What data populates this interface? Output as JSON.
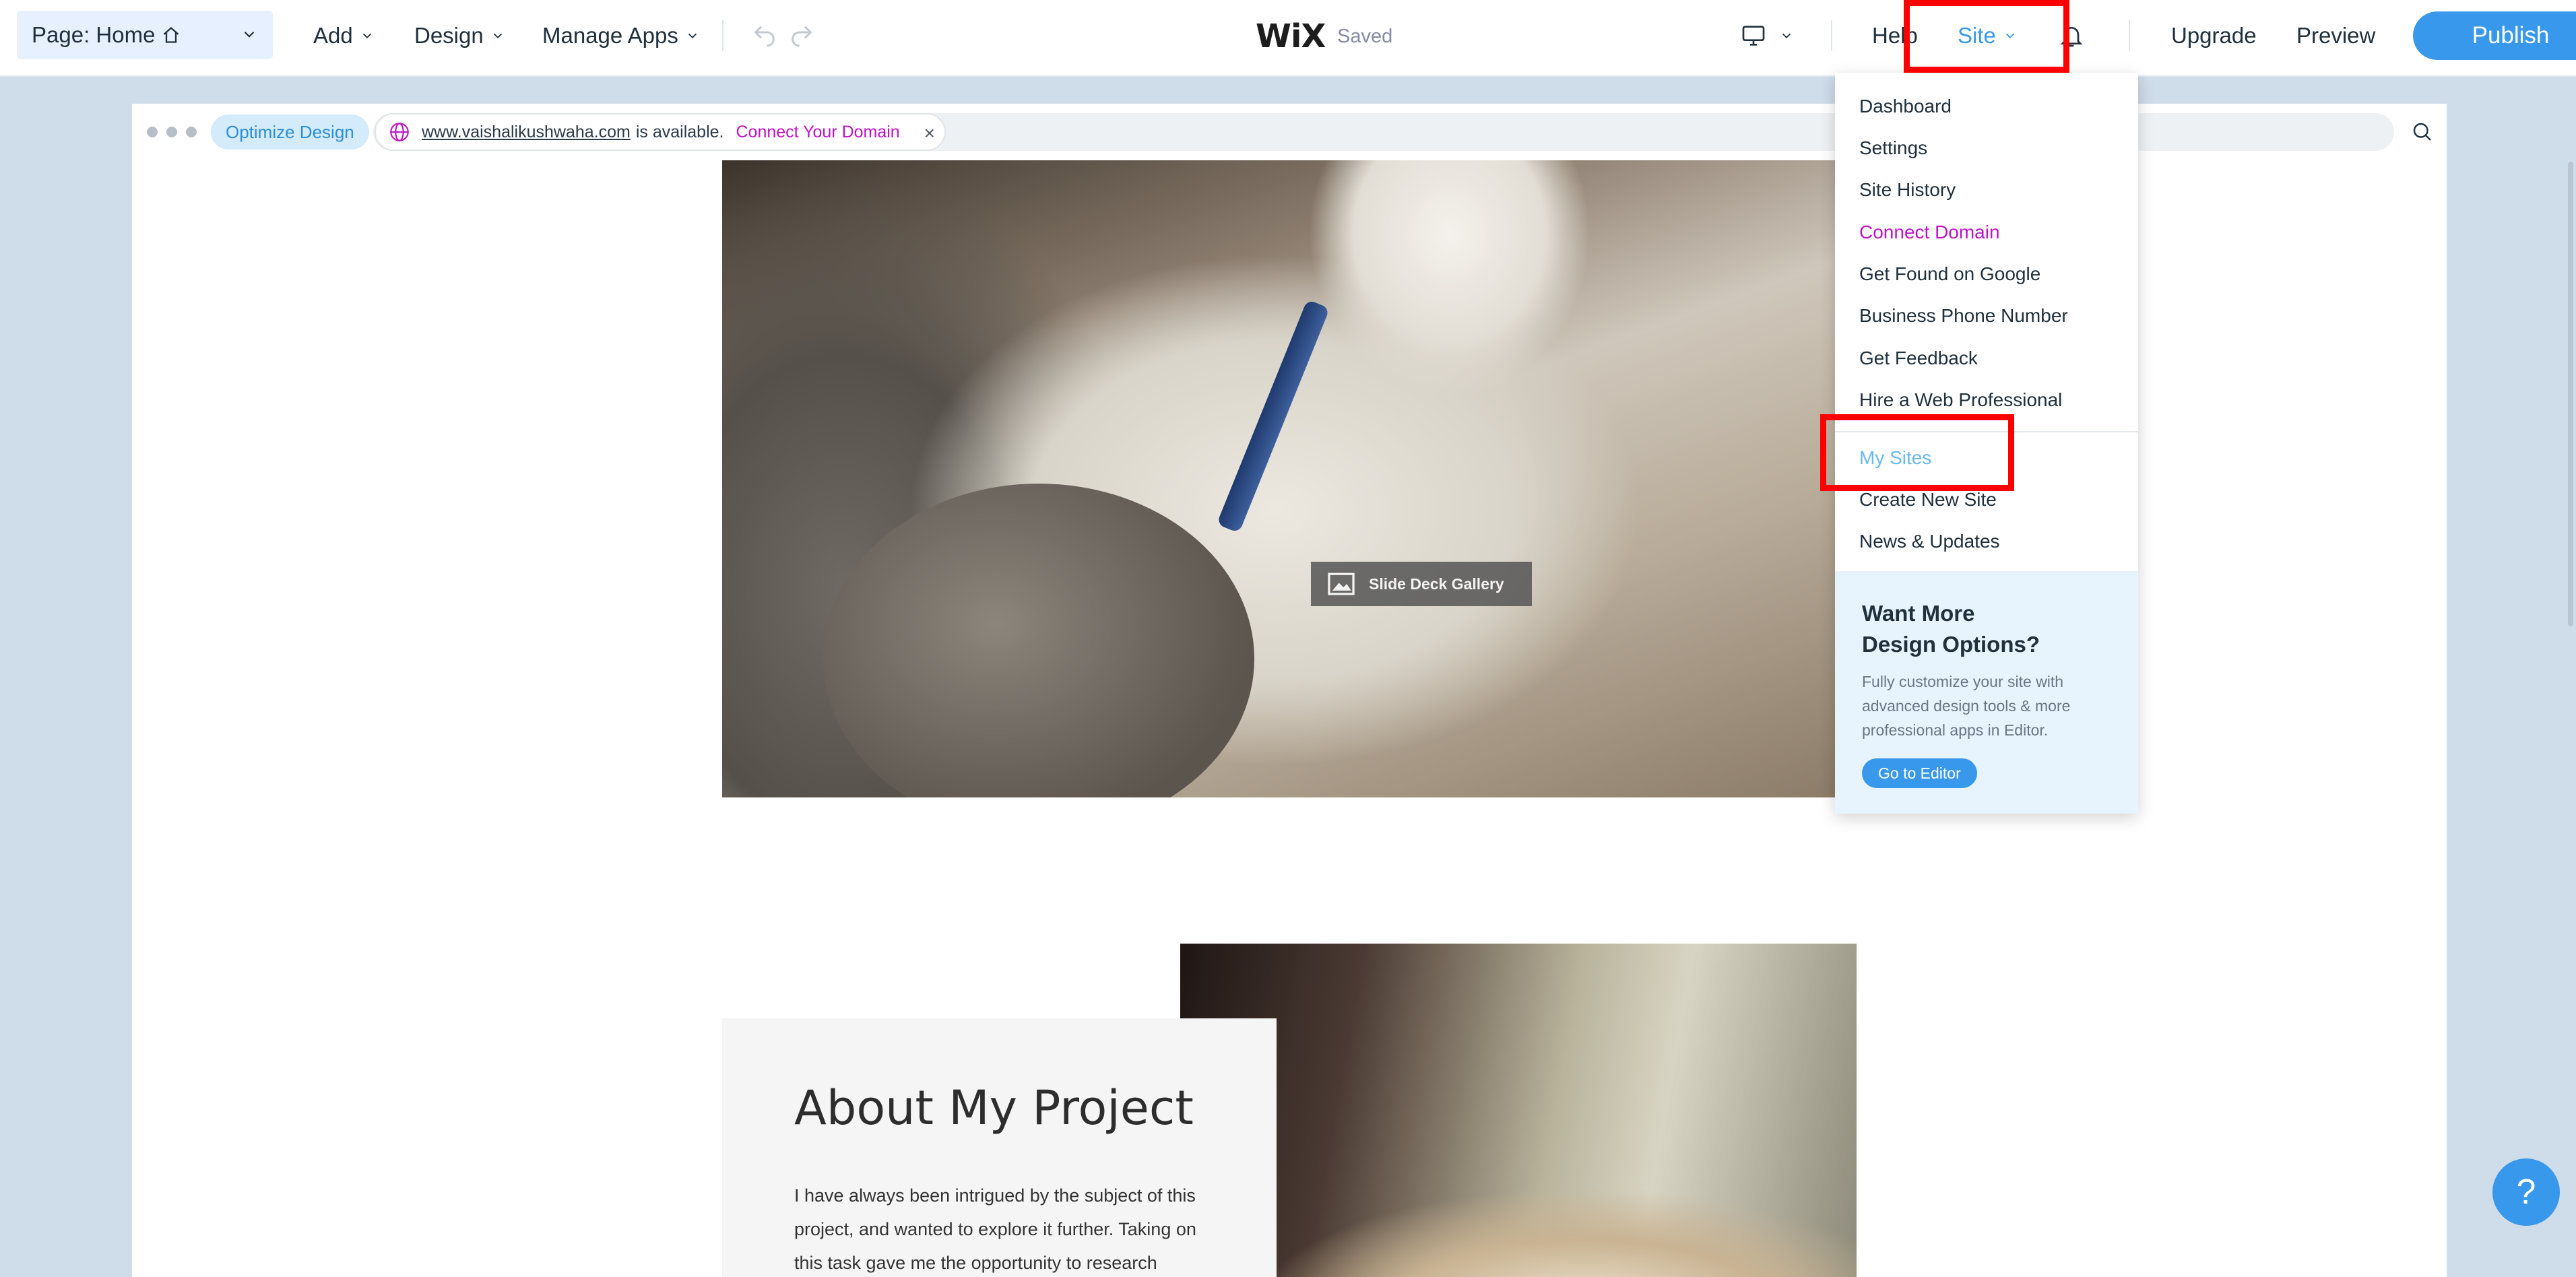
{
  "topbar": {
    "page_label": "Page: Home",
    "menus": [
      "Add",
      "Design",
      "Manage Apps"
    ],
    "logo": "WiX",
    "status": "Saved",
    "help": "Help",
    "site": "Site",
    "upgrade": "Upgrade",
    "preview": "Preview",
    "publish": "Publish"
  },
  "frame": {
    "optimize": "Optimize Design",
    "domain_url": "www.vaishalikushwaha.com",
    "domain_available": "is available.",
    "domain_connect": "Connect Your Domain",
    "close": "×"
  },
  "content": {
    "gallery_label": "Slide Deck Gallery",
    "about_title": "About My Project",
    "about_body": "I have always been intrigued by the subject of this project, and wanted to explore it further. Taking on this task gave me the opportunity to research"
  },
  "site_menu": {
    "items": [
      "Dashboard",
      "Settings",
      "Site History",
      "Connect Domain",
      "Get Found on Google",
      "Business Phone Number",
      "Get Feedback",
      "Hire a Web Professional"
    ],
    "items2": [
      "My Sites",
      "Create New Site",
      "News & Updates"
    ],
    "upsell_title_1": "Want More",
    "upsell_title_2": "Design Options?",
    "upsell_body": "Fully customize your site with advanced design tools & more professional apps in Editor.",
    "upsell_button": "Go to Editor"
  },
  "help_bubble": "?",
  "colors": {
    "accent": "#3899ec",
    "connect": "#c013c9",
    "highlight": "#ff0000",
    "my_sites": "#68b9f0"
  },
  "icons": [
    "home-icon",
    "chevron-down-icon",
    "undo-icon",
    "redo-icon",
    "desktop-icon",
    "bell-icon",
    "globe-icon",
    "search-icon",
    "image-icon"
  ]
}
